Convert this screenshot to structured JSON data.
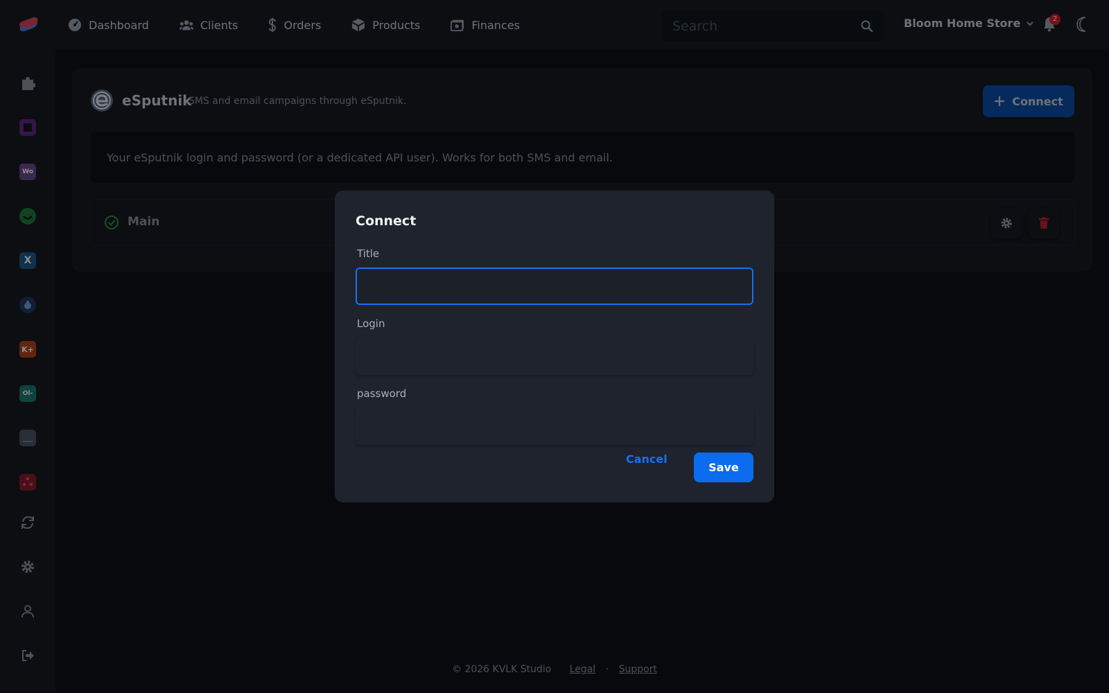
{
  "nav": {
    "items": [
      {
        "label": "Dashboard",
        "icon": "dashboard-icon"
      },
      {
        "label": "Clients",
        "icon": "users-icon"
      },
      {
        "label": "Orders",
        "icon": "dollar-icon"
      },
      {
        "label": "Products",
        "icon": "box-icon"
      },
      {
        "label": "Finances",
        "icon": "money-icon"
      }
    ]
  },
  "search": {
    "placeholder": "Search",
    "value": ""
  },
  "store": {
    "name": "Bloom Home Store"
  },
  "notifications": {
    "count": "2"
  },
  "integration": {
    "name": "eSputnik",
    "description": "SMS and email campaigns through eSputnik.",
    "connect_label": "Connect",
    "info": "Your eSputnik login and password (or a dedicated API user). Works for both SMS and email.",
    "connection": {
      "label": "Main",
      "status": "connected"
    }
  },
  "modal": {
    "title": "Connect",
    "fields": [
      {
        "label": "Title",
        "value": ""
      },
      {
        "label": "Login",
        "value": ""
      },
      {
        "label": "password",
        "value": ""
      }
    ],
    "cancel_label": "Cancel",
    "save_label": "Save"
  },
  "footer": {
    "copyright": "© 2026 KVLK Studio",
    "links": [
      "Legal",
      "Support"
    ],
    "separator": "·"
  },
  "colors": {
    "accent": "#0b6cf0",
    "background": "#0d1117",
    "panel": "#161b22",
    "modal": "#1e232d",
    "success": "#2ea043",
    "danger": "#e11d2a"
  }
}
